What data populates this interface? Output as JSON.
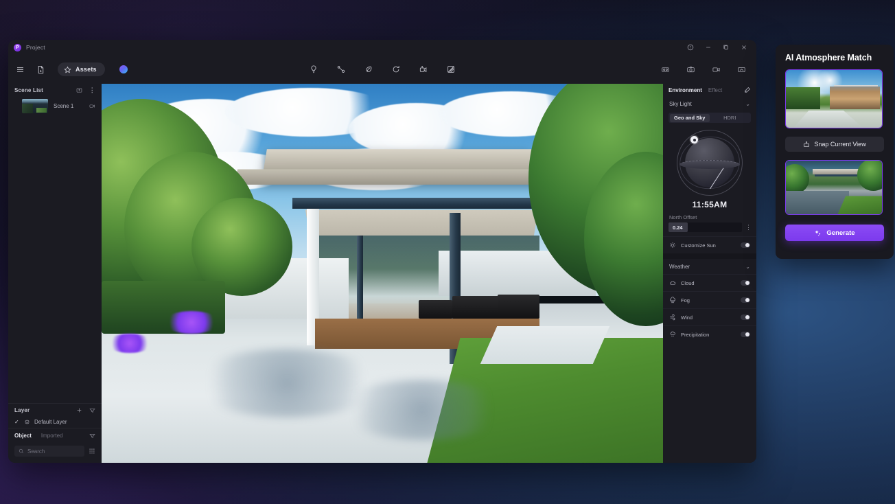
{
  "window": {
    "project_label": "Project",
    "project_initial": "P",
    "controls": {
      "help": "?",
      "minimize": "–",
      "maximize": "❐",
      "close": "✕"
    }
  },
  "toolbar": {
    "menu_icon": "hamburger-menu-icon",
    "file_icon": "file-import-icon",
    "assets_label": "Assets",
    "assets_icon": "assets-star-icon",
    "avatar": "user-avatar",
    "center_tools": [
      {
        "name": "light-tool",
        "icon": "bulb-icon"
      },
      {
        "name": "measure-tool",
        "icon": "line-measure-icon"
      },
      {
        "name": "material-tool",
        "icon": "leaf-paint-icon"
      },
      {
        "name": "rotate-tool",
        "icon": "refresh-rotate-icon"
      },
      {
        "name": "animation-tool",
        "icon": "animate-icon"
      },
      {
        "name": "render-tool",
        "icon": "render-grid-icon"
      }
    ],
    "right_tools": [
      {
        "name": "panorama-tool",
        "icon": "panorama-icon"
      },
      {
        "name": "snapshot-tool",
        "icon": "camera-icon"
      },
      {
        "name": "video-tool",
        "icon": "video-camera-icon"
      },
      {
        "name": "export-tool",
        "icon": "export-tray-icon"
      }
    ]
  },
  "left_panel": {
    "scene_list": {
      "title": "Scene List",
      "add_icon": "add-scene-icon",
      "more_icon": "more-vertical-icon",
      "scenes": [
        {
          "name": "Scene 1",
          "camera_icon": "camera-small-icon"
        }
      ]
    },
    "layer": {
      "title": "Layer",
      "add_icon": "plus-icon",
      "filter_icon": "filter-icon",
      "items": [
        {
          "name": "Default Layer",
          "checked": "✓",
          "icon": "layer-icon"
        }
      ]
    },
    "object": {
      "tab_active": "Object",
      "tab_inactive": "Imported",
      "filter_icon": "filter-icon",
      "search_placeholder": "Search",
      "search_icon": "search-icon",
      "grid_icon": "grid-view-icon"
    }
  },
  "properties": {
    "tab_active": "Environment",
    "tab_inactive": "Effect",
    "reset_icon": "reset-icon",
    "sky_light": {
      "title": "Sky Light",
      "chevron": "⌄",
      "segments": [
        {
          "label": "Geo and Sky",
          "active": true
        },
        {
          "label": "HDRI",
          "active": false
        }
      ],
      "sun_widget": "sun-position-sphere",
      "time": "11:55AM",
      "north_offset_label": "North Offset",
      "north_offset_value": "0.24",
      "more_icon": "more-vertical-icon",
      "customize_sun": {
        "label": "Customize Sun",
        "icon": "sun-icon",
        "on": true
      }
    },
    "weather": {
      "title": "Weather",
      "chevron": "⌄",
      "rows": [
        {
          "label": "Cloud",
          "icon": "cloud-icon",
          "on": true
        },
        {
          "label": "Fog",
          "icon": "fog-icon",
          "on": true
        },
        {
          "label": "Wind",
          "icon": "wind-icon",
          "on": true
        },
        {
          "label": "Precipitation",
          "icon": "precipitation-icon",
          "on": true
        }
      ]
    }
  },
  "ai_panel": {
    "title": "AI Atmosphere Match",
    "reference_thumb": "reference-image-thumbnail",
    "snap_button": {
      "label": "Snap Current View",
      "icon": "snapshot-icon"
    },
    "current_thumb": "current-view-thumbnail",
    "generate_button": {
      "label": "Generate",
      "icon": "sparkle-icon"
    }
  },
  "colors": {
    "accent_purple": "#7c3aed",
    "panel_bg": "#1b1b22",
    "window_bg": "#1b1b22",
    "text_primary": "#e6e6ee",
    "text_muted": "#8b8b96"
  }
}
